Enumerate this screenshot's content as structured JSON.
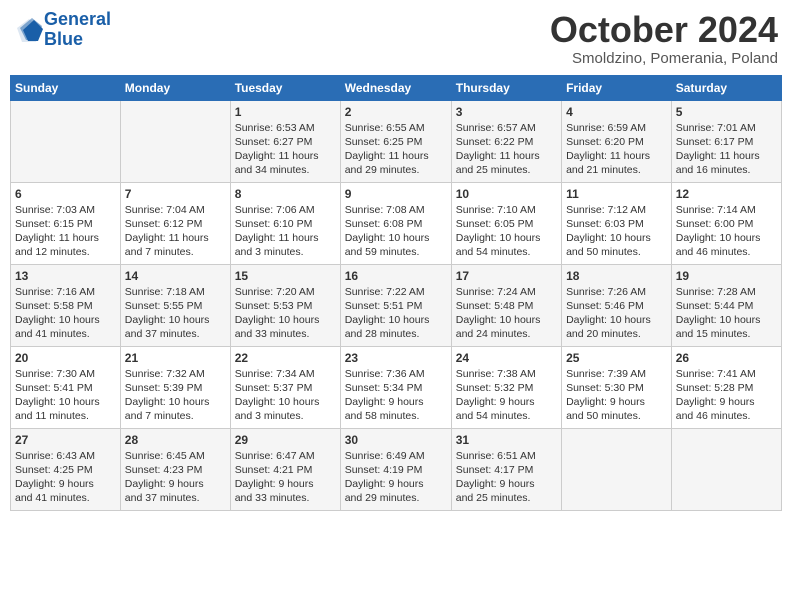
{
  "logo": {
    "line1": "General",
    "line2": "Blue"
  },
  "title": "October 2024",
  "subtitle": "Smoldzino, Pomerania, Poland",
  "days_header": [
    "Sunday",
    "Monday",
    "Tuesday",
    "Wednesday",
    "Thursday",
    "Friday",
    "Saturday"
  ],
  "weeks": [
    [
      {
        "day": "",
        "info": ""
      },
      {
        "day": "",
        "info": ""
      },
      {
        "day": "1",
        "info": "Sunrise: 6:53 AM\nSunset: 6:27 PM\nDaylight: 11 hours\nand 34 minutes."
      },
      {
        "day": "2",
        "info": "Sunrise: 6:55 AM\nSunset: 6:25 PM\nDaylight: 11 hours\nand 29 minutes."
      },
      {
        "day": "3",
        "info": "Sunrise: 6:57 AM\nSunset: 6:22 PM\nDaylight: 11 hours\nand 25 minutes."
      },
      {
        "day": "4",
        "info": "Sunrise: 6:59 AM\nSunset: 6:20 PM\nDaylight: 11 hours\nand 21 minutes."
      },
      {
        "day": "5",
        "info": "Sunrise: 7:01 AM\nSunset: 6:17 PM\nDaylight: 11 hours\nand 16 minutes."
      }
    ],
    [
      {
        "day": "6",
        "info": "Sunrise: 7:03 AM\nSunset: 6:15 PM\nDaylight: 11 hours\nand 12 minutes."
      },
      {
        "day": "7",
        "info": "Sunrise: 7:04 AM\nSunset: 6:12 PM\nDaylight: 11 hours\nand 7 minutes."
      },
      {
        "day": "8",
        "info": "Sunrise: 7:06 AM\nSunset: 6:10 PM\nDaylight: 11 hours\nand 3 minutes."
      },
      {
        "day": "9",
        "info": "Sunrise: 7:08 AM\nSunset: 6:08 PM\nDaylight: 10 hours\nand 59 minutes."
      },
      {
        "day": "10",
        "info": "Sunrise: 7:10 AM\nSunset: 6:05 PM\nDaylight: 10 hours\nand 54 minutes."
      },
      {
        "day": "11",
        "info": "Sunrise: 7:12 AM\nSunset: 6:03 PM\nDaylight: 10 hours\nand 50 minutes."
      },
      {
        "day": "12",
        "info": "Sunrise: 7:14 AM\nSunset: 6:00 PM\nDaylight: 10 hours\nand 46 minutes."
      }
    ],
    [
      {
        "day": "13",
        "info": "Sunrise: 7:16 AM\nSunset: 5:58 PM\nDaylight: 10 hours\nand 41 minutes."
      },
      {
        "day": "14",
        "info": "Sunrise: 7:18 AM\nSunset: 5:55 PM\nDaylight: 10 hours\nand 37 minutes."
      },
      {
        "day": "15",
        "info": "Sunrise: 7:20 AM\nSunset: 5:53 PM\nDaylight: 10 hours\nand 33 minutes."
      },
      {
        "day": "16",
        "info": "Sunrise: 7:22 AM\nSunset: 5:51 PM\nDaylight: 10 hours\nand 28 minutes."
      },
      {
        "day": "17",
        "info": "Sunrise: 7:24 AM\nSunset: 5:48 PM\nDaylight: 10 hours\nand 24 minutes."
      },
      {
        "day": "18",
        "info": "Sunrise: 7:26 AM\nSunset: 5:46 PM\nDaylight: 10 hours\nand 20 minutes."
      },
      {
        "day": "19",
        "info": "Sunrise: 7:28 AM\nSunset: 5:44 PM\nDaylight: 10 hours\nand 15 minutes."
      }
    ],
    [
      {
        "day": "20",
        "info": "Sunrise: 7:30 AM\nSunset: 5:41 PM\nDaylight: 10 hours\nand 11 minutes."
      },
      {
        "day": "21",
        "info": "Sunrise: 7:32 AM\nSunset: 5:39 PM\nDaylight: 10 hours\nand 7 minutes."
      },
      {
        "day": "22",
        "info": "Sunrise: 7:34 AM\nSunset: 5:37 PM\nDaylight: 10 hours\nand 3 minutes."
      },
      {
        "day": "23",
        "info": "Sunrise: 7:36 AM\nSunset: 5:34 PM\nDaylight: 9 hours\nand 58 minutes."
      },
      {
        "day": "24",
        "info": "Sunrise: 7:38 AM\nSunset: 5:32 PM\nDaylight: 9 hours\nand 54 minutes."
      },
      {
        "day": "25",
        "info": "Sunrise: 7:39 AM\nSunset: 5:30 PM\nDaylight: 9 hours\nand 50 minutes."
      },
      {
        "day": "26",
        "info": "Sunrise: 7:41 AM\nSunset: 5:28 PM\nDaylight: 9 hours\nand 46 minutes."
      }
    ],
    [
      {
        "day": "27",
        "info": "Sunrise: 6:43 AM\nSunset: 4:25 PM\nDaylight: 9 hours\nand 41 minutes."
      },
      {
        "day": "28",
        "info": "Sunrise: 6:45 AM\nSunset: 4:23 PM\nDaylight: 9 hours\nand 37 minutes."
      },
      {
        "day": "29",
        "info": "Sunrise: 6:47 AM\nSunset: 4:21 PM\nDaylight: 9 hours\nand 33 minutes."
      },
      {
        "day": "30",
        "info": "Sunrise: 6:49 AM\nSunset: 4:19 PM\nDaylight: 9 hours\nand 29 minutes."
      },
      {
        "day": "31",
        "info": "Sunrise: 6:51 AM\nSunset: 4:17 PM\nDaylight: 9 hours\nand 25 minutes."
      },
      {
        "day": "",
        "info": ""
      },
      {
        "day": "",
        "info": ""
      }
    ]
  ]
}
